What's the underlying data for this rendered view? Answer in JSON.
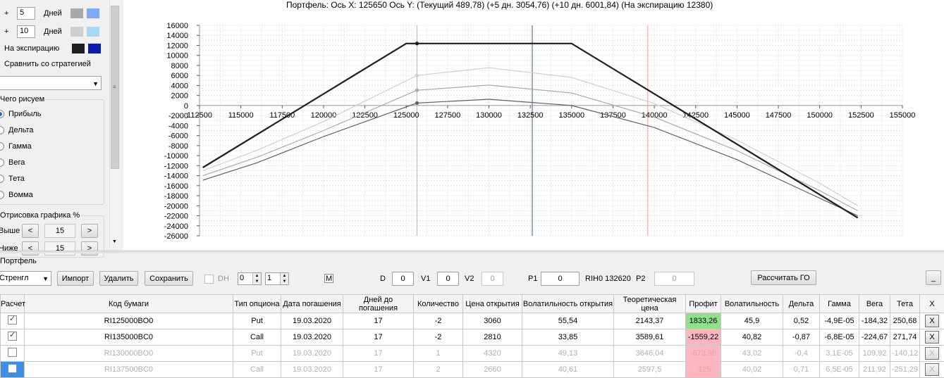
{
  "left": {
    "rows": [
      {
        "prefix": "+",
        "value": "5",
        "unit": "Дней",
        "color1": "#a9a9a9",
        "color2": "#7eaaf7"
      },
      {
        "prefix": "+",
        "value": "10",
        "unit": "Дней",
        "color1": "#cfcfcf",
        "color2": "#a6d8f7"
      }
    ],
    "expiry_label": "На экспирацию",
    "expiry_color1": "#1e1e1e",
    "expiry_color2": "#0a1bb3",
    "compare_label": "Сравнить со стратегией",
    "draw_group_title": "Чего рисуем",
    "draw_options": [
      "Прибыль",
      "Дельта",
      "Гамма",
      "Вега",
      "Тета",
      "Вомма"
    ],
    "draw_selected": "Прибыль",
    "pct_group_title": "Отрисовка графика %",
    "higher_label": "Выше",
    "higher_value": "15",
    "lower_label": "Ниже",
    "lower_value": "15",
    "prev_glyph": "<",
    "next_glyph": ">"
  },
  "chart_header": "Портфель: Ось X:  125650 Ось Y:   (Текущий 489,78)   (+5 дн. 3054,76)   (+10 дн. 6001,84)   (На экспирацию 12380)",
  "chart_data": {
    "type": "line",
    "xlim": [
      112500,
      155000
    ],
    "ylim": [
      -26000,
      16000
    ],
    "x_ticks": [
      112500,
      115000,
      117500,
      120000,
      122500,
      125000,
      127500,
      130000,
      132500,
      135000,
      137500,
      140000,
      142500,
      145000,
      147500,
      150000,
      152500,
      155000
    ],
    "y_ticks": [
      16000,
      14000,
      12000,
      10000,
      8000,
      6000,
      4000,
      2000,
      0,
      -2000,
      -4000,
      -6000,
      -8000,
      -10000,
      -12000,
      -14000,
      -16000,
      -18000,
      -20000,
      -22000,
      -24000,
      -26000
    ],
    "current_x": 125650,
    "underlying_x": 132620,
    "vlines_red": [
      125650,
      139600
    ],
    "grid": true,
    "series": [
      {
        "points": [
          [
            112700,
            -12380
          ],
          [
            125000,
            12380
          ],
          [
            135000,
            12380
          ],
          [
            152300,
            -22400
          ]
        ],
        "color": "#1e1e1e",
        "width": 2.2
      },
      {
        "points": [
          [
            112700,
            -13000
          ],
          [
            116000,
            -8900
          ],
          [
            120000,
            -3200
          ],
          [
            125650,
            6002
          ],
          [
            130000,
            7550
          ],
          [
            135000,
            5600
          ],
          [
            140000,
            400
          ],
          [
            145000,
            -6900
          ],
          [
            150000,
            -15500
          ],
          [
            152300,
            -20000
          ]
        ],
        "color": "#cfcfcf",
        "width": 1.2
      },
      {
        "points": [
          [
            112700,
            -14000
          ],
          [
            116000,
            -10300
          ],
          [
            120000,
            -5000
          ],
          [
            125650,
            3055
          ],
          [
            130000,
            4080
          ],
          [
            135000,
            2500
          ],
          [
            140000,
            -2300
          ],
          [
            145000,
            -9000
          ],
          [
            150000,
            -17000
          ],
          [
            152300,
            -21000
          ]
        ],
        "color": "#a9a9a9",
        "width": 1.2
      },
      {
        "points": [
          [
            112700,
            -14900
          ],
          [
            116000,
            -11400
          ],
          [
            120000,
            -6200
          ],
          [
            125650,
            490
          ],
          [
            130000,
            1250
          ],
          [
            135000,
            0
          ],
          [
            140000,
            -4400
          ],
          [
            145000,
            -10800
          ],
          [
            150000,
            -18500
          ],
          [
            152300,
            -22000
          ]
        ],
        "color": "#606060",
        "width": 1.2
      }
    ]
  },
  "portfolio": {
    "title": "Портфель",
    "combo_value": "Стренгл",
    "import_label": "Импорт",
    "delete_label": "Удалить",
    "save_label": "Сохранить",
    "dh_label": "DH",
    "spin1": "0",
    "spin2": "1",
    "m_label": "M",
    "d_label": "D",
    "d_value": "0",
    "v1_label": "V1",
    "v1_value": "0",
    "v2_label": "V2",
    "v2_value": "0",
    "p1_label": "P1",
    "p1_value": "0",
    "instrument": "RIH0 132620",
    "p2_label": "P2",
    "p2_value": "0",
    "calc_go_label": "Рассчитать ГО",
    "min_label": "_"
  },
  "table": {
    "headers": [
      "Расчет",
      "Код бумаги",
      "Тип опциона",
      "Дата погашения",
      "Дней до погашения",
      "Количество",
      "Цена открытия",
      "Волатильность открытия",
      "Теоретическая цена",
      "Профит",
      "Волатильность",
      "Дельта",
      "Гамма",
      "Вега",
      "Тета",
      "X"
    ],
    "rows": [
      {
        "checked": true,
        "code": "RI125000BO0",
        "type": "Put",
        "date": "19.03.2020",
        "days": "17",
        "qty": "-2",
        "price": "3060",
        "vol_open": "55,54",
        "theo": "2143,37",
        "profit": "1833,26",
        "profit_sign": "pos",
        "vol": "45,9",
        "delta": "0,52",
        "gamma": "-4,9E-05",
        "vega": "-184,32",
        "theta": "250,68",
        "x": "X",
        "active": true
      },
      {
        "checked": true,
        "code": "RI135000BC0",
        "type": "Call",
        "date": "19.03.2020",
        "days": "17",
        "qty": "-2",
        "price": "2810",
        "vol_open": "33,85",
        "theo": "3589,61",
        "profit": "-1559,22",
        "profit_sign": "neg",
        "vol": "40,82",
        "delta": "-0,87",
        "gamma": "-6,8E-05",
        "vega": "-224,67",
        "theta": "271,74",
        "x": "X",
        "active": true
      },
      {
        "checked": false,
        "code": "RI130000BO0",
        "type": "Put",
        "date": "19.03.2020",
        "days": "17",
        "qty": "1",
        "price": "4320",
        "vol_open": "49,13",
        "theo": "3646,04",
        "profit": "-673,96",
        "profit_sign": "neg",
        "vol": "43,02",
        "delta": "-0,4",
        "gamma": "3,1E-05",
        "vega": "109,92",
        "theta": "-140,12",
        "x": "X",
        "active": false
      },
      {
        "checked": false,
        "code": "RI137500BC0",
        "type": "Call",
        "date": "19.03.2020",
        "days": "17",
        "qty": "2",
        "price": "2660",
        "vol_open": "40,61",
        "theo": "2597,5",
        "profit": "-125",
        "profit_sign": "neg",
        "vol": "40,02",
        "delta": "0,71",
        "gamma": "6,5E-05",
        "vega": "211,92",
        "theta": "-251,29",
        "x": "X",
        "active": false
      }
    ]
  }
}
